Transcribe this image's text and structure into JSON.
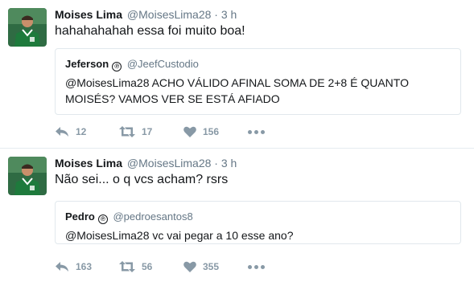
{
  "tweets": [
    {
      "name": "Moises Lima",
      "handle": "@MoisesLima28",
      "separator": "·",
      "time": "3 h",
      "text": "hahahahahah essa foi muito boa!",
      "quote": {
        "name": "Jeferson",
        "badge": "℗",
        "handle": "@JeefCustodio",
        "text": "@MoisesLima28 ACHO VÁLIDO AFINAL SOMA DE 2+8 É QUANTO MOISÉS? VAMOS VER SE ESTÁ AFIADO"
      },
      "replies": "12",
      "retweets": "17",
      "likes": "156"
    },
    {
      "name": "Moises Lima",
      "handle": "@MoisesLima28",
      "separator": "·",
      "time": "3 h",
      "text": "Não sei... o q vcs acham? rsrs",
      "quote": {
        "name": "Pedro",
        "badge": "℗",
        "handle": "@pedroesantos8",
        "text": "@MoisesLima28 vc vai pegar a 10 esse ano?"
      },
      "replies": "163",
      "retweets": "56",
      "likes": "355"
    }
  ],
  "icons": {
    "reply": "reply-icon",
    "retweet": "retweet-icon",
    "like": "heart-icon",
    "more": "more-icon"
  },
  "colors": {
    "text": "#14171a",
    "muted": "#657786",
    "icon": "#8899a6",
    "border": "#e1e8ed",
    "jersey": "#1e7a3c"
  }
}
